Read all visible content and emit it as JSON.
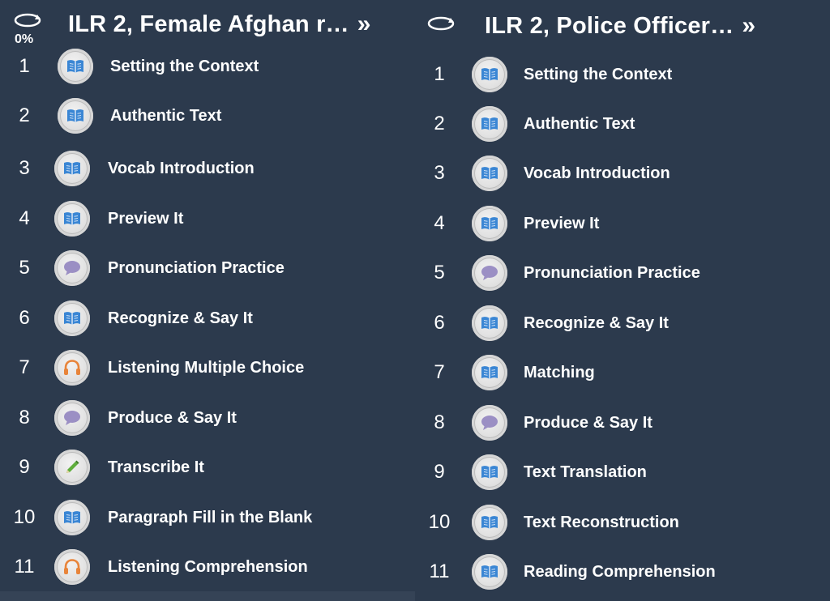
{
  "left_panel": {
    "title": "ILR 2, Female Afghan r…",
    "expand_icon": "double-chevron-right-icon",
    "progress": "0%",
    "refresh_icon": "refresh-icon",
    "items": [
      {
        "num": "1",
        "label": "Setting the Context",
        "icon": "book-icon"
      },
      {
        "num": "2",
        "label": "Authentic Text",
        "icon": "book-icon"
      },
      {
        "num": "3",
        "label": "Vocab Introduction",
        "icon": "book-icon"
      },
      {
        "num": "4",
        "label": "Preview It",
        "icon": "book-icon"
      },
      {
        "num": "5",
        "label": "Pronunciation Practice",
        "icon": "speech-bubble-icon"
      },
      {
        "num": "6",
        "label": "Recognize & Say It",
        "icon": "book-icon"
      },
      {
        "num": "7",
        "label": "Listening Multiple Choice",
        "icon": "headphones-icon"
      },
      {
        "num": "8",
        "label": "Produce & Say It",
        "icon": "speech-bubble-icon"
      },
      {
        "num": "9",
        "label": "Transcribe It",
        "icon": "pencil-icon"
      },
      {
        "num": "10",
        "label": "Paragraph Fill in the Blank",
        "icon": "book-icon"
      },
      {
        "num": "11",
        "label": "Listening Comprehension",
        "icon": "headphones-icon"
      }
    ]
  },
  "right_panel": {
    "title": "ILR 2, Police Officer…",
    "expand_icon": "double-chevron-right-icon",
    "refresh_icon": "refresh-icon",
    "items": [
      {
        "num": "1",
        "label": "Setting the Context",
        "icon": "book-icon"
      },
      {
        "num": "2",
        "label": "Authentic Text",
        "icon": "book-icon"
      },
      {
        "num": "3",
        "label": "Vocab Introduction",
        "icon": "book-icon"
      },
      {
        "num": "4",
        "label": "Preview It",
        "icon": "book-icon"
      },
      {
        "num": "5",
        "label": "Pronunciation Practice",
        "icon": "speech-bubble-icon"
      },
      {
        "num": "6",
        "label": "Recognize & Say It",
        "icon": "book-icon"
      },
      {
        "num": "7",
        "label": "Matching",
        "icon": "book-icon"
      },
      {
        "num": "8",
        "label": "Produce & Say It",
        "icon": "speech-bubble-icon"
      },
      {
        "num": "9",
        "label": "Text Translation",
        "icon": "book-icon"
      },
      {
        "num": "10",
        "label": "Text Reconstruction",
        "icon": "book-icon"
      },
      {
        "num": "11",
        "label": "Reading Comprehension",
        "icon": "book-icon"
      }
    ]
  },
  "colors": {
    "background": "#2c3a4d",
    "book": "#3a86d4",
    "speech": "#9b8fc4",
    "headphones": "#e8843a",
    "pencil": "#5fae3c"
  },
  "chevron_glyph": "»"
}
